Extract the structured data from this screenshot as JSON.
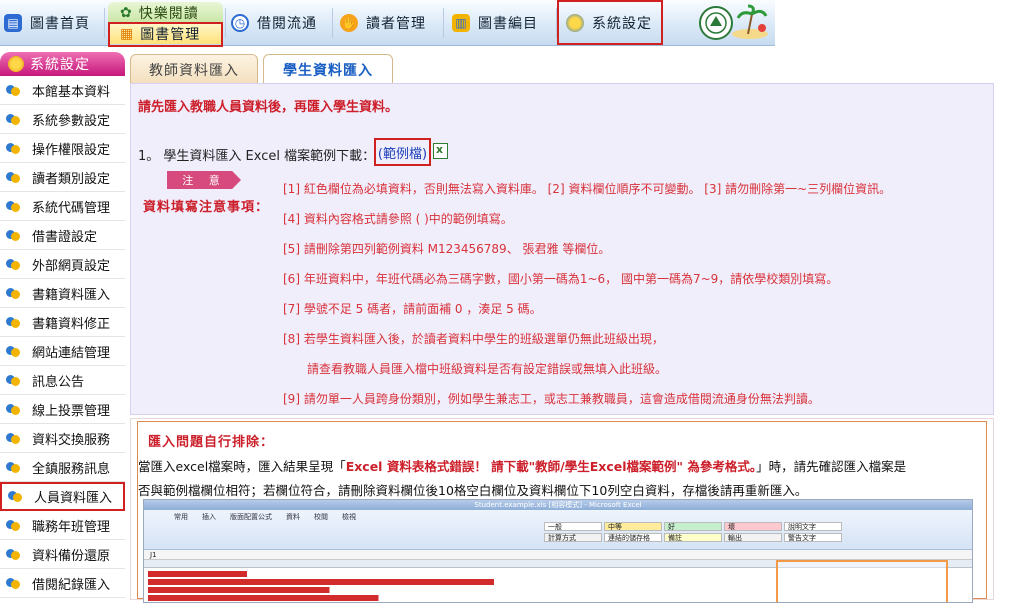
{
  "topnav": {
    "home": "圖書首頁",
    "happy_reading": "快樂閱讀",
    "book_management": "圖書管理",
    "circulation": "借閱流通",
    "reader_management": "讀者管理",
    "cataloging": "圖書編目",
    "system_settings": "系統設定"
  },
  "sidebar": {
    "header": "系統設定",
    "items": [
      {
        "label": "本館基本資料"
      },
      {
        "label": "系統參數設定"
      },
      {
        "label": "操作權限設定"
      },
      {
        "label": "讀者類別設定"
      },
      {
        "label": "系統代碼管理"
      },
      {
        "label": "借書證設定"
      },
      {
        "label": "外部網頁設定"
      },
      {
        "label": "書籍資料匯入"
      },
      {
        "label": "書籍資料修正"
      },
      {
        "label": "網站連結管理"
      },
      {
        "label": "訊息公告"
      },
      {
        "label": "線上投票管理"
      },
      {
        "label": "資料交換服務"
      },
      {
        "label": "全鎮服務訊息"
      },
      {
        "label": "人員資料匯入"
      },
      {
        "label": "職務年班管理"
      },
      {
        "label": "資料備份還原"
      },
      {
        "label": "借閱紀錄匯入"
      }
    ],
    "active_index": 14
  },
  "tabs": {
    "teacher": "教師資料匯入",
    "student": "學生資料匯入"
  },
  "main": {
    "warning": "請先匯入教職人員資料後，再匯入學生資料。",
    "download_text": "1。 學生資料匯入 Excel 檔案範例下載：",
    "sample_link": "(範例檔)",
    "note_tag": "注 意",
    "notes_heading": "資料填寫注意事項：",
    "notes": [
      "[1] 紅色欄位為必填資料，否則無法寫入資料庫。 [2] 資料欄位順序不可變動。 [3] 請勿刪除第一~三列欄位資訊。",
      "[4] 資料內容格式請參照 ( )中的範例填寫。",
      "[5] 請刪除第四列範例資料 M123456789、 張君雅 等欄位。",
      "[6] 年班資料中，年班代碼必為三碼字數，國小第一碼為1~6， 國中第一碼為7~9，請依學校類別填寫。",
      "[7] 學號不足 5 碼者，請前面補 0 ，湊足 5 碼。",
      "[8] 若學生資料匯入後，於讀者資料中學生的班級選單仍無此班級出現，",
      "請查看教職人員匯入檔中班級資料是否有設定錯誤或無填入此班級。",
      "[9] 請勿單一人員跨身份類別，例如學生兼志工，或志工兼教職員，這會造成借閱流通身份無法判讀。"
    ]
  },
  "troubleshoot": {
    "title": "匯入問題自行排除：",
    "line1_pre": "當匯入excel檔案時，匯入結果呈現「",
    "line1_error": "Excel 資料表格式錯誤！ 請下載\"教師/學生Excel檔案範例\" 為參考格式。",
    "line1_post": "」時，請先確認匯入檔案是",
    "line2": "否與範例檔欄位相符；若欄位符合，請刪除資料欄位後10格空白欄位及資料欄位下10列空白資料，存檔後請再重新匯入。"
  },
  "excel_shot": {
    "title": "Student.example.xls [相容模式] - Microsoft Excel",
    "ribbon_tabs": [
      "常用",
      "插入",
      "版面配置",
      "公式",
      "資料",
      "校閱",
      "檢視"
    ],
    "styles": [
      "一般",
      "中等",
      "好",
      "壞",
      "說明文字",
      "計算方式",
      "連結的儲存格",
      "備註",
      "輸出",
      "警告文字"
    ],
    "cell_ref": "J1",
    "colors": {
      "accent": "#d12b2b",
      "highlight": "#f29a4a"
    }
  }
}
